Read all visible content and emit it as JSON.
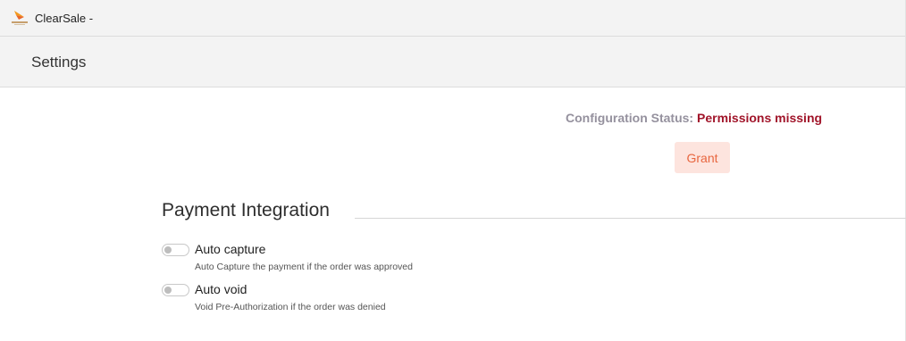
{
  "app": {
    "title": "ClearSale -",
    "logo_icon": "clearsale-logo-icon"
  },
  "page": {
    "title": "Settings"
  },
  "status": {
    "label": "Configuration Status:",
    "value": "Permissions missing",
    "label_color": "#95919e",
    "value_color": "#a1152a"
  },
  "actions": {
    "grant_label": "Grant",
    "grant_bg": "#fde4de",
    "grant_color": "#e8663f"
  },
  "payment_integration": {
    "title": "Payment Integration",
    "options": [
      {
        "label": "Auto capture",
        "description": "Auto Capture the payment if the order was approved",
        "enabled": false
      },
      {
        "label": "Auto void",
        "description": "Void Pre-Authorization if the order was denied",
        "enabled": false
      }
    ]
  }
}
